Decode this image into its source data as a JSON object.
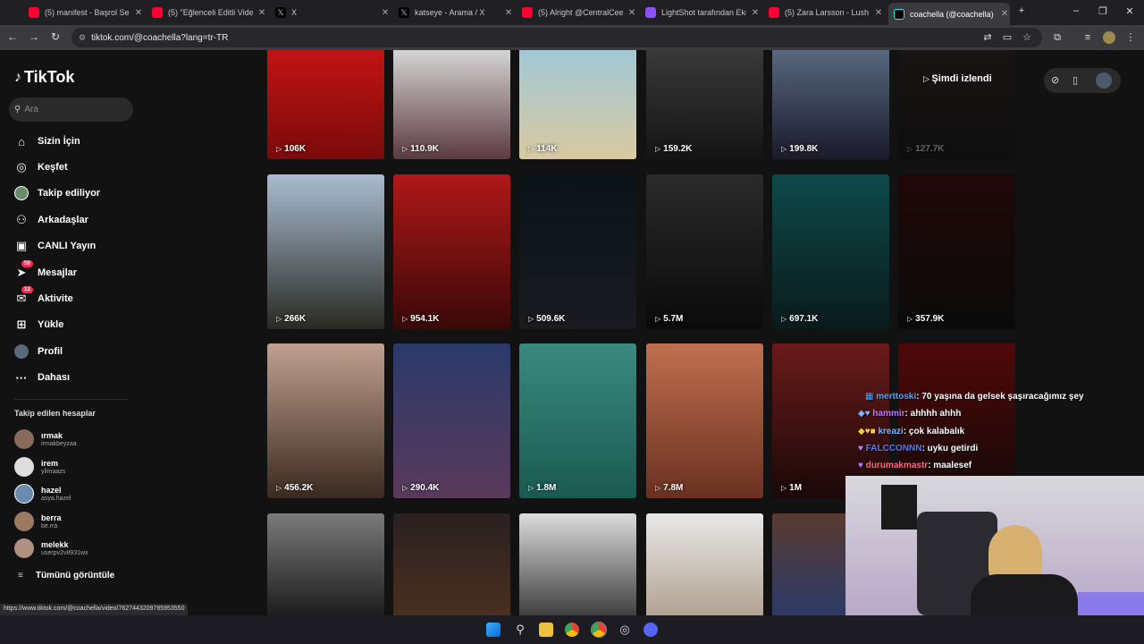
{
  "tabs": [
    {
      "label": "(5) manifest - Başrol Sens",
      "color": "#ff0033"
    },
    {
      "label": "(5) \"Eğlenceli Editli Video",
      "color": "#ff0033"
    },
    {
      "label": "X",
      "color": "#000000"
    },
    {
      "label": "katseye - Arama / X",
      "color": "#000000"
    },
    {
      "label": "(5) Alright @CentralCee -",
      "color": "#ff0033"
    },
    {
      "label": "LightShot tarafından Ekra",
      "color": "#8a4fff"
    },
    {
      "label": "(5) Zara Larsson - Lush Li",
      "color": "#ff0033"
    },
    {
      "label": "coachella (@coachella) | T",
      "color": "#000000"
    }
  ],
  "url": "tiktok.com/@coachella?lang=tr-TR",
  "logo": "TikTok",
  "search": {
    "placeholder": "Ara"
  },
  "nav": [
    {
      "label": "Sizin İçin",
      "icon": "home-icon"
    },
    {
      "label": "Keşfet",
      "icon": "compass-icon"
    },
    {
      "label": "Takip ediliyor",
      "icon": "avatar-icon"
    },
    {
      "label": "Arkadaşlar",
      "icon": "friends-icon"
    },
    {
      "label": "CANLI Yayın",
      "icon": "live-icon"
    },
    {
      "label": "Mesajlar",
      "icon": "message-icon",
      "badge": "50"
    },
    {
      "label": "Aktivite",
      "icon": "activity-icon",
      "badge": "13"
    },
    {
      "label": "Yükle",
      "icon": "upload-icon"
    },
    {
      "label": "Profil",
      "icon": "profile-icon"
    },
    {
      "label": "Dahası",
      "icon": "more-icon"
    }
  ],
  "following_title": "Takip edilen hesaplar",
  "accounts": [
    {
      "name": "ırmak",
      "handle": "irmakbeyzaa",
      "color": "#8a6a5a"
    },
    {
      "name": "irem",
      "handle": "yilmaazs",
      "color": "#dddddd"
    },
    {
      "name": "hazel",
      "handle": "asya.hazel",
      "color": "#6a8ab0"
    },
    {
      "name": "berra",
      "handle": "be.rra",
      "color": "#9a7a60"
    },
    {
      "name": "melekk",
      "handle": "userpv2v8931wx",
      "color": "#b09080"
    }
  ],
  "see_all": "Tümünü görüntüle",
  "now_watching": "Şimdi izlendi",
  "videos": [
    {
      "views": "106K",
      "bg": "linear-gradient(180deg,#c41414,#7a0a0a)"
    },
    {
      "views": "110.9K",
      "bg": "linear-gradient(180deg,#d9d9d9,#5a3a40)"
    },
    {
      "views": "114K",
      "bg": "linear-gradient(180deg,#9fc8d8,#d9c9a0)"
    },
    {
      "views": "159.2K",
      "bg": "linear-gradient(180deg,#3a3a3a,#141414)"
    },
    {
      "views": "199.8K",
      "bg": "linear-gradient(180deg,#5a6a80,#1a1a2a)"
    },
    {
      "views": "127.7K",
      "bg": "linear-gradient(180deg,#1a1414,#0e0e0e)"
    },
    {
      "views": "266K",
      "bg": "linear-gradient(180deg,#a9bcd0,#2a2a24)"
    },
    {
      "views": "954.1K",
      "bg": "linear-gradient(180deg,#b01818,#3a0808)"
    },
    {
      "views": "509.6K",
      "bg": "linear-gradient(180deg,#0a1418,#1a1a20)"
    },
    {
      "views": "5.7M",
      "bg": "linear-gradient(180deg,#2a2a2a,#0a0a0a)"
    },
    {
      "views": "697.1K",
      "bg": "linear-gradient(180deg,#0e4a4a,#0a1a1a)"
    },
    {
      "views": "357.9K",
      "bg": "linear-gradient(180deg,#200808,#0a0a0a)"
    },
    {
      "views": "456.2K",
      "bg": "linear-gradient(180deg,#c0a090,#3a2a20)"
    },
    {
      "views": "290.4K",
      "bg": "linear-gradient(180deg,#2a3a6a,#5a3a5a)"
    },
    {
      "views": "1.8M",
      "bg": "linear-gradient(180deg,#3a8a80,#1a5a50)"
    },
    {
      "views": "7.8M",
      "bg": "linear-gradient(180deg,#c07050,#6a3020)"
    },
    {
      "views": "1M",
      "bg": "linear-gradient(180deg,#6a1a1a,#1a0808)"
    },
    {
      "views": "",
      "bg": "linear-gradient(180deg,#500808,#140808)"
    },
    {
      "views": "",
      "bg": "linear-gradient(180deg,#7a7a7a,#1a1a1a)"
    },
    {
      "views": "",
      "bg": "linear-gradient(180deg,#2a2020,#4a3020)"
    },
    {
      "views": "",
      "bg": "linear-gradient(180deg,#dcdcdc,#3a3a3a)"
    },
    {
      "views": "",
      "bg": "linear-gradient(180deg,#e8e8e8,#b0a090)"
    },
    {
      "views": "",
      "bg": "linear-gradient(180deg,#5a3a30,#2a3a6a)"
    }
  ],
  "chat": [
    {
      "user": "merttoski",
      "msg": ": 70 yaşına da gelsek şaşıracağımız şey",
      "color": "#4aa8ff"
    },
    {
      "user": "hammir",
      "msg": ": ahhhh ahhh",
      "color": "#c07aff"
    },
    {
      "user": "kreazi",
      "msg": ": çok kalabalık",
      "color": "#7ab8ff"
    },
    {
      "user": "FALCCONNN",
      "msg": ": uyku getirdi",
      "color": "#5a7aff"
    },
    {
      "user": "durumakmastr",
      "msg": ": maalesef",
      "color": "#ff6a8a"
    }
  ],
  "status_url": "https://www.tiktok.com/@coachella/video/7627443209785953550"
}
